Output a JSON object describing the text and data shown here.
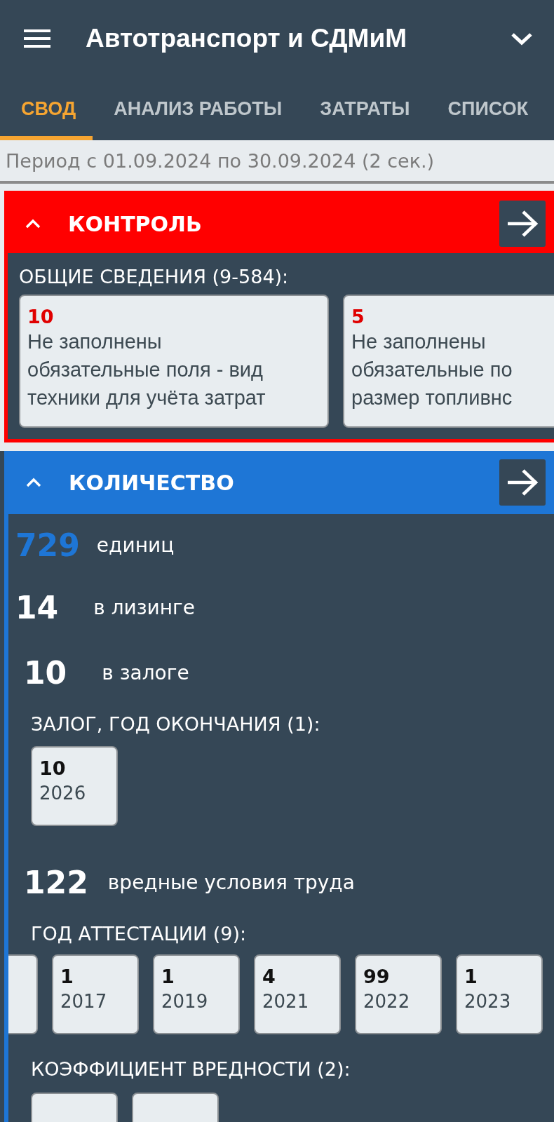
{
  "app_bar": {
    "title": "Автотранспорт и СДМиМ"
  },
  "tabs": [
    {
      "label": "СВОД",
      "selected": true
    },
    {
      "label": "АНАЛИЗ РАБОТЫ",
      "selected": false
    },
    {
      "label": "ЗАТРАТЫ",
      "selected": false
    },
    {
      "label": "СПИСОК",
      "selected": false
    }
  ],
  "period": "Период с 01.09.2024 по 30.09.2024 (2 сек.)",
  "control": {
    "title": "КОНТРОЛЬ",
    "expanded": true,
    "group_title": "ОБЩИЕ СВЕДЕНИЯ (9-584):",
    "cards": [
      {
        "count": "10",
        "lines": [
          "Не заполнены",
          "обязательные поля - вид",
          "техники для учёта затрат"
        ]
      },
      {
        "count": "5",
        "lines": [
          "Не заполнены",
          "обязательные по",
          "размер топливнс"
        ]
      }
    ]
  },
  "quantity": {
    "title": "КОЛИЧЕСТВО",
    "expanded": true,
    "stats": [
      {
        "value": "729",
        "label": "единиц",
        "accent": true
      },
      {
        "value": "14",
        "label": "в лизинге",
        "accent": false
      },
      {
        "value": "10",
        "label": "в залоге",
        "accent": false
      }
    ],
    "pledge": {
      "title": "ЗАЛОГ, ГОД ОКОНЧАНИЯ (1):",
      "cards": [
        {
          "kind": "card",
          "count": "10",
          "year": "2026"
        }
      ]
    },
    "harmful": {
      "value": "122",
      "label": "вредные условия труда"
    },
    "attestation": {
      "title": "ГОД АТТЕСТАЦИИ (9):",
      "cards": [
        {
          "kind": "edge"
        },
        {
          "kind": "card",
          "count": "1",
          "year": "2017"
        },
        {
          "kind": "card",
          "count": "1",
          "year": "2019"
        },
        {
          "kind": "card",
          "count": "4",
          "year": "2021"
        },
        {
          "kind": "card",
          "count": "99",
          "year": "2022"
        },
        {
          "kind": "card",
          "count": "1",
          "year": "2023"
        }
      ]
    },
    "coefficient": {
      "title": "КОЭФФИЦИЕНТ ВРЕДНОСТИ (2):",
      "cards": [
        {
          "kind": "top"
        },
        {
          "kind": "top"
        }
      ]
    }
  }
}
